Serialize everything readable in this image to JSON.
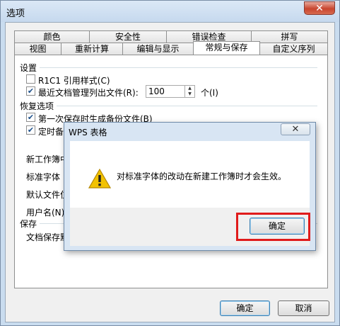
{
  "window": {
    "title": "选项",
    "close_glyph": "✕"
  },
  "tabs_row1": [
    "颜色",
    "安全性",
    "错误检查",
    "拼写"
  ],
  "tabs_row2": [
    "视图",
    "重新计算",
    "编辑与显示",
    "常规与保存",
    "自定义序列"
  ],
  "active_tab": "常规与保存",
  "settings": {
    "section_label": "设置",
    "r1c1_label": "R1C1 引用样式(C)",
    "r1c1_checked": false,
    "recent_label": "最近文档管理列出文件(R):",
    "recent_checked": true,
    "recent_count": "100",
    "recent_unit": "个(I)"
  },
  "recovery": {
    "section_label": "恢复选项",
    "backup_label": "第一次保存时生成备份文件(B)",
    "backup_checked": true,
    "timed_label": "定时备",
    "timed_checked": true
  },
  "general": {
    "new_workbook_label": "新工作簿中",
    "std_font_label": "标准字体",
    "default_file_label": "默认文件位",
    "username_label": "用户名(N)"
  },
  "save": {
    "section_label": "保存",
    "format_label": "文档保存默"
  },
  "buttons": {
    "ok": "确定",
    "cancel": "取消"
  },
  "message_box": {
    "title": "WPS 表格",
    "close_glyph": "✕",
    "icon": "warning-icon",
    "text": "对标准字体的改动在新建工作簿时才会生效。",
    "ok": "确定"
  },
  "colors": {
    "highlight": "#e01b1b",
    "warning": "#f2c200"
  }
}
